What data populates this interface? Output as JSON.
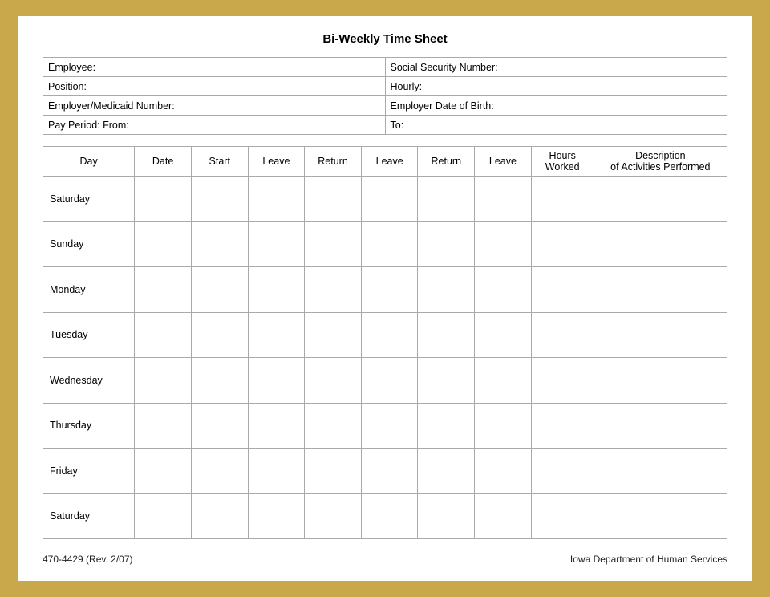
{
  "title": "Bi-Weekly Time Sheet",
  "info_rows": [
    {
      "left_label": "Employee:",
      "right_label": "Social Security Number:"
    },
    {
      "left_label": "Position:",
      "right_label": "Hourly:"
    },
    {
      "left_label": "Employer/Medicaid Number:",
      "right_label": "Employer Date of Birth:"
    },
    {
      "left_label": "Pay Period:  From:",
      "right_label": "To:"
    }
  ],
  "table_headers": [
    "Day",
    "Date",
    "Start",
    "Leave",
    "Return",
    "Leave",
    "Return",
    "Leave",
    "Hours Worked",
    "Description of Activities Performed"
  ],
  "days": [
    "Saturday",
    "Sunday",
    "Monday",
    "Tuesday",
    "Wednesday",
    "Thursday",
    "Friday",
    "Saturday"
  ],
  "footer": {
    "left": "470-4429  (Rev. 2/07)",
    "right": "Iowa Department of Human Services"
  }
}
